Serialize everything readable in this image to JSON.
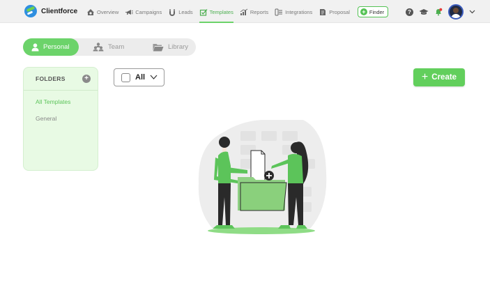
{
  "app": {
    "name": "Clientforce"
  },
  "nav": {
    "items": [
      {
        "label": "Overview",
        "icon": "overview-icon"
      },
      {
        "label": "Campaigns",
        "icon": "campaigns-icon"
      },
      {
        "label": "Leads",
        "icon": "leads-icon"
      },
      {
        "label": "Templates",
        "icon": "templates-icon",
        "active": true
      },
      {
        "label": "Reports",
        "icon": "reports-icon"
      },
      {
        "label": "Integrations",
        "icon": "integrations-icon"
      },
      {
        "label": "Proposal",
        "icon": "proposal-icon"
      }
    ],
    "finder_label": "Finder"
  },
  "tabs": [
    {
      "label": "Personal",
      "active": true
    },
    {
      "label": "Team"
    },
    {
      "label": "Library"
    }
  ],
  "folders": {
    "title": "FOLDERS",
    "items": [
      {
        "label": "All Templates",
        "active": true
      },
      {
        "label": "General"
      }
    ]
  },
  "filter": {
    "label": "All"
  },
  "create": {
    "label": "Create"
  },
  "colors": {
    "accent": "#62cf5c",
    "accent_light": "#e8fae4",
    "active_text": "#4caf50"
  }
}
